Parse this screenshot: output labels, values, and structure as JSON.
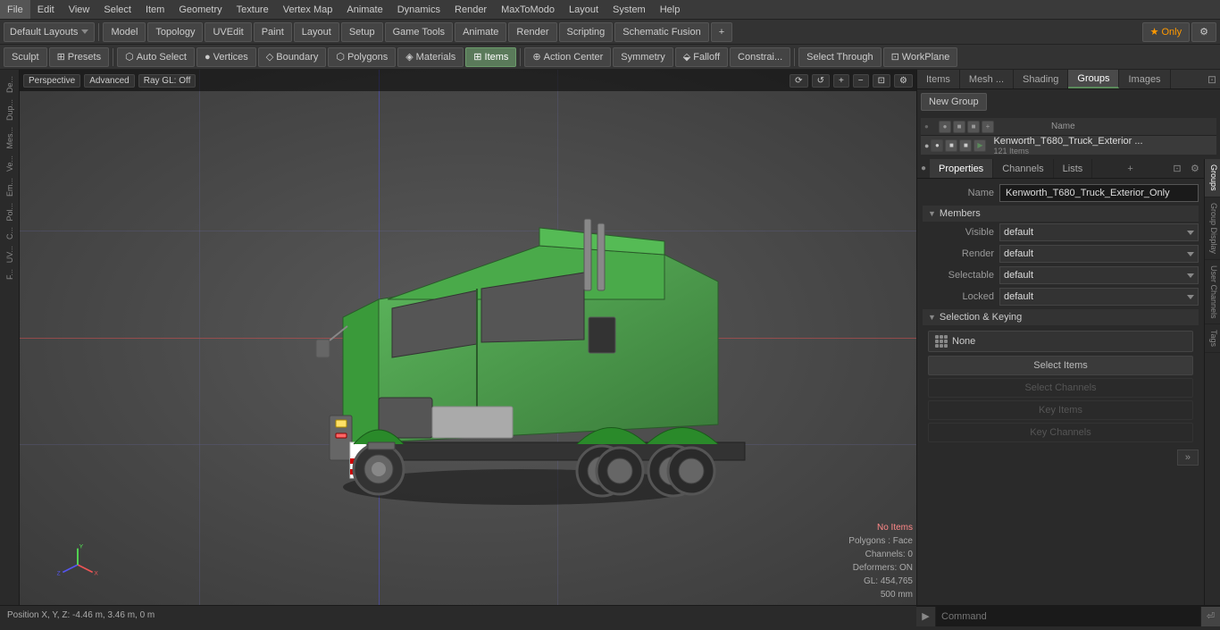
{
  "menu": {
    "items": [
      "File",
      "Edit",
      "View",
      "Select",
      "Item",
      "Geometry",
      "Texture",
      "Vertex Map",
      "Animate",
      "Dynamics",
      "Render",
      "MaxToModo",
      "Layout",
      "System",
      "Help"
    ]
  },
  "toolbar1": {
    "layout_label": "Default Layouts",
    "modes": [
      "Model",
      "Topology",
      "UVEdit",
      "Paint",
      "Layout",
      "Setup",
      "Game Tools",
      "Animate",
      "Render",
      "Scripting",
      "Schematic Fusion"
    ],
    "star_label": "★ Only",
    "plus_label": "+"
  },
  "toolbar2": {
    "sculpt_label": "Sculpt",
    "presets_label": "Presets",
    "auto_select": "Auto Select",
    "vertices": "Vertices",
    "boundary": "Boundary",
    "polygons": "Polygons",
    "materials": "Materials",
    "items": "Items",
    "action_center": "Action Center",
    "symmetry": "Symmetry",
    "falloff": "Falloff",
    "constraints": "Constrai...",
    "select_through": "Select Through",
    "workplane": "WorkPlane"
  },
  "viewport": {
    "mode": "Perspective",
    "advanced": "Advanced",
    "ray_gl": "Ray GL: Off",
    "no_items": "No Items",
    "polygons": "Polygons : Face",
    "channels": "Channels: 0",
    "deformers": "Deformers: ON",
    "gl_count": "GL: 454,765",
    "size": "500 mm"
  },
  "left_sidebar": {
    "items": [
      "De...",
      "Dup...",
      "Mes...",
      "Ve...",
      "Em...",
      "Pol...",
      "C...",
      "UV...",
      "F..."
    ]
  },
  "right_panel": {
    "tabs": [
      "Items",
      "Mesh ...",
      "Shading",
      "Groups",
      "Images"
    ],
    "active_tab": "Groups",
    "new_group_btn": "New Group",
    "header_name": "Name",
    "group": {
      "name": "Kenworth_T680_Truck_Exterior ...",
      "sub": "121 Items"
    }
  },
  "properties": {
    "tabs": [
      "Properties",
      "Channels",
      "Lists"
    ],
    "active_tab": "Properties",
    "add_btn": "+",
    "name_label": "Name",
    "name_value": "Kenworth_T680_Truck_Exterior_Only",
    "members_label": "Members",
    "visible_label": "Visible",
    "visible_value": "default",
    "render_label": "Render",
    "render_value": "default",
    "selectable_label": "Selectable",
    "selectable_value": "default",
    "locked_label": "Locked",
    "locked_value": "default",
    "selection_keying": "Selection & Keying",
    "none_label": "None",
    "select_items_label": "Select Items",
    "select_channels_label": "Select Channels",
    "key_items_label": "Key Items",
    "key_channels_label": "Key Channels"
  },
  "vtabs": {
    "items": [
      "Groups",
      "Group Display",
      "User Channels",
      "Tags"
    ]
  },
  "command_bar": {
    "toggle": "▶",
    "placeholder": "Command",
    "submit": "⏎"
  },
  "status_bar": {
    "position": "Position X, Y, Z:  -4.46 m, 3.46 m, 0 m"
  }
}
